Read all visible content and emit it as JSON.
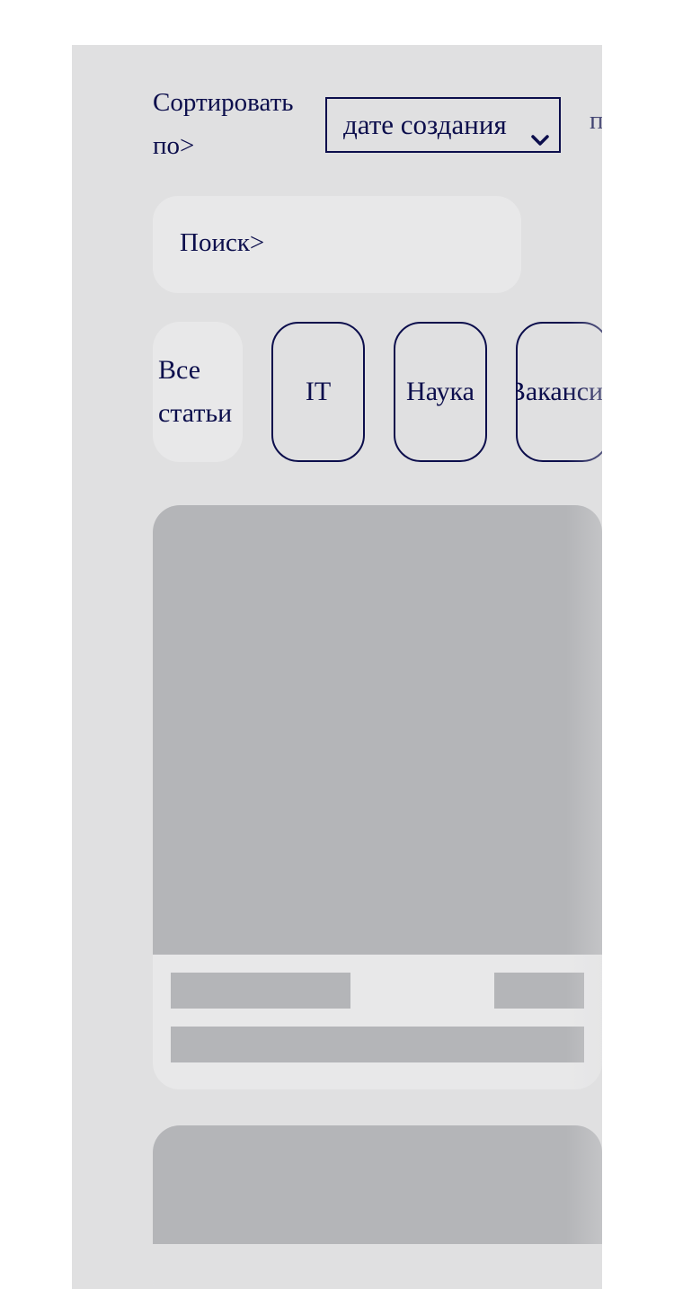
{
  "sort": {
    "label": "Сортировать по>",
    "selected": "дате создания",
    "trailing": "п"
  },
  "search": {
    "placeholder": "Поиск>"
  },
  "categories": [
    {
      "label": "Все статьи",
      "active": true
    },
    {
      "label": "IT",
      "active": false
    },
    {
      "label": "Наука",
      "active": false
    },
    {
      "label": "Вакансии",
      "active": false
    }
  ],
  "colors": {
    "accent": "#0c0e4c",
    "panel": "#e0e0e1",
    "card": "#e8e8e9",
    "skeleton": "#b4b5b8"
  },
  "icons": {
    "sort_dropdown": "chevron-down-icon"
  }
}
